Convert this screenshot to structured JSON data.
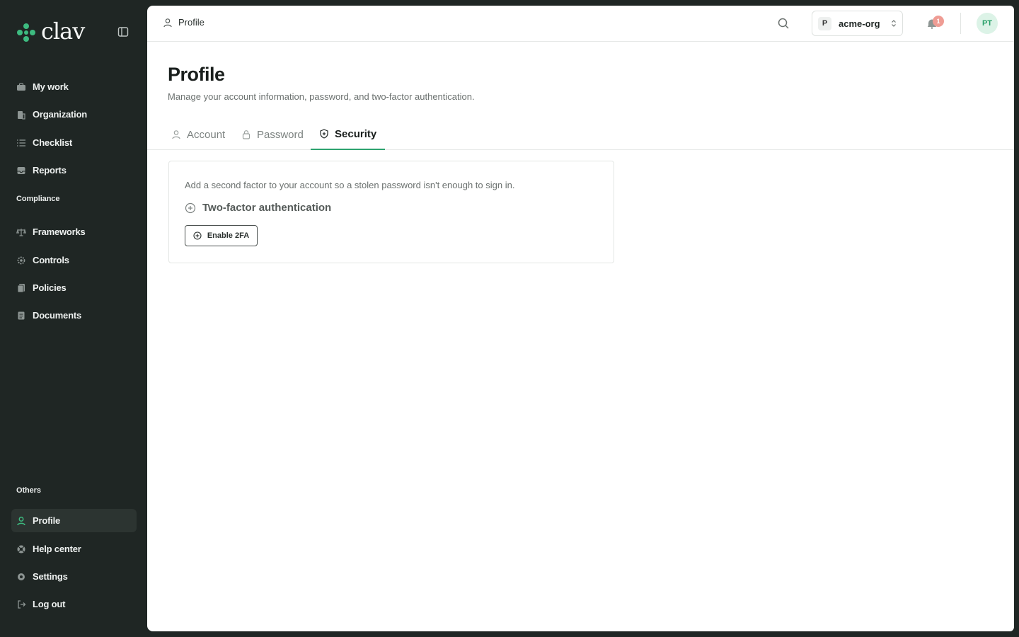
{
  "brand": {
    "name": "clav",
    "accent": "#2ea36f"
  },
  "sidebar": {
    "main_items": [
      {
        "label": "My work",
        "icon": "briefcase-icon"
      },
      {
        "label": "Organization",
        "icon": "building-icon"
      },
      {
        "label": "Checklist",
        "icon": "list-icon"
      },
      {
        "label": "Reports",
        "icon": "inbox-icon"
      }
    ],
    "compliance_label": "Compliance",
    "compliance_items": [
      {
        "label": "Frameworks",
        "icon": "scale-icon"
      },
      {
        "label": "Controls",
        "icon": "cog-icon"
      },
      {
        "label": "Policies",
        "icon": "files-icon"
      },
      {
        "label": "Documents",
        "icon": "document-icon"
      }
    ],
    "others_label": "Others",
    "other_items": [
      {
        "label": "Profile",
        "icon": "user-icon",
        "active": true
      },
      {
        "label": "Help center",
        "icon": "lifebuoy-icon"
      },
      {
        "label": "Settings",
        "icon": "gear-icon"
      },
      {
        "label": "Log out",
        "icon": "logout-icon"
      }
    ]
  },
  "header": {
    "breadcrumb": "Profile",
    "org": {
      "badge": "P",
      "name": "acme-org"
    },
    "notifications": "1",
    "avatar_initials": "PT"
  },
  "page": {
    "title": "Profile",
    "subtitle": "Manage your account information, password, and two-factor authentication."
  },
  "tabs": [
    {
      "label": "Account",
      "icon": "user-icon"
    },
    {
      "label": "Password",
      "icon": "lock-icon"
    },
    {
      "label": "Security",
      "icon": "shield-plus-icon",
      "active": true
    }
  ],
  "security_card": {
    "description": "Add a second factor to your account so a stolen password isn't enough to sign in.",
    "heading": "Two-factor authentication",
    "button_label": "Enable 2FA"
  }
}
